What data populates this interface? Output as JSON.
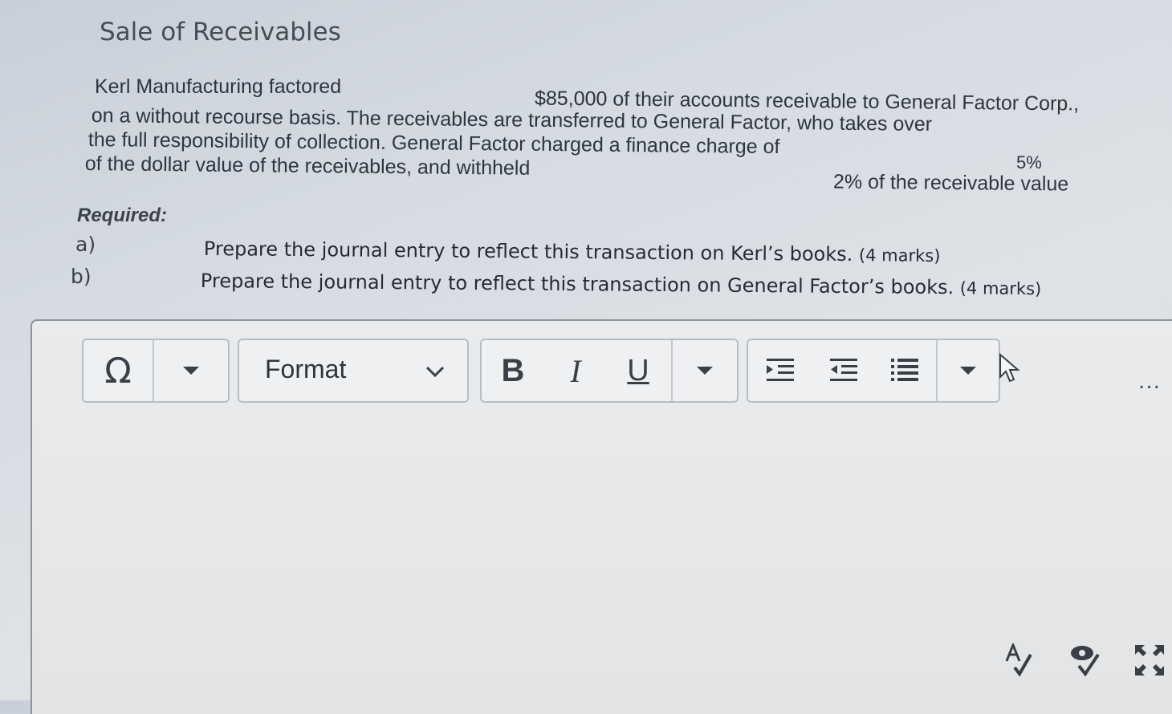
{
  "title": "Sale of Receivables",
  "paragraph": {
    "line1_start": "Kerl Manufacturing factored",
    "amount": "$85,000",
    "line1_end": "of their accounts receivable to General Factor Corp.,",
    "line2": "on a without recourse basis. The receivables are transferred to General Factor, who takes over",
    "line3": "the full responsibility of collection. General Factor charged a finance charge of",
    "finance_rate": "5%",
    "line4": "of the dollar value of the receivables, and withheld",
    "withheld_rate": "2%",
    "line4_end": "of the receivable value"
  },
  "required_label": "Required:",
  "questions": [
    {
      "label": "a)",
      "text": "Prepare the journal entry to reflect this transaction on Kerl’s books.",
      "marks": "(4 marks)"
    },
    {
      "label": "b)",
      "text": "Prepare the journal entry to reflect this transaction on General Factor’s books.",
      "marks": "(4 marks)"
    }
  ],
  "toolbar": {
    "special_char_icon": "omega-icon",
    "format_label": "Format",
    "bold_label": "B",
    "italic_label": "I",
    "underline_label": "U",
    "more_label": "..."
  },
  "editor": {
    "content": ""
  }
}
